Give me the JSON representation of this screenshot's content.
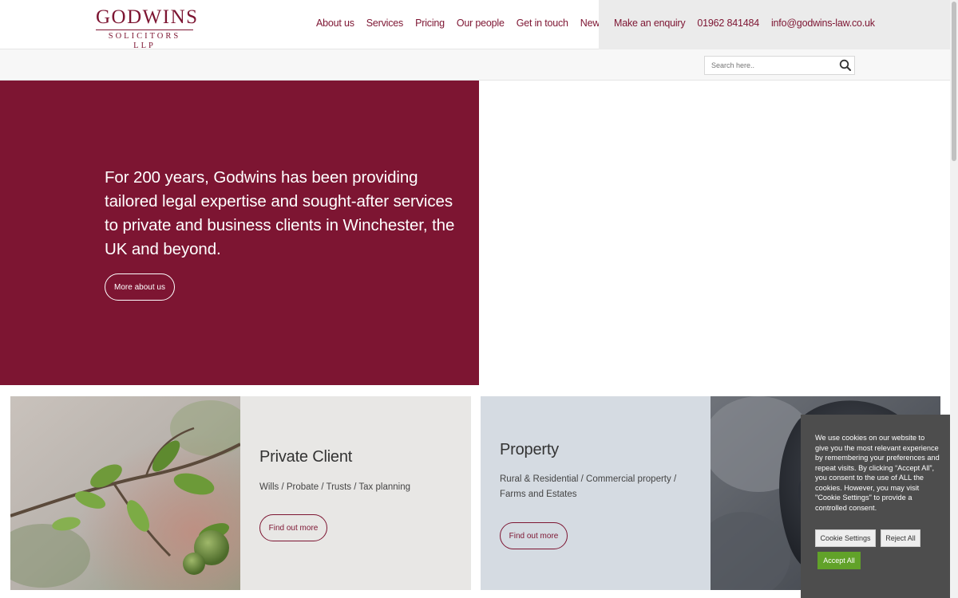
{
  "logo": {
    "main": "GODWINS",
    "sub": "SOLICITORS LLP"
  },
  "nav": [
    {
      "label": "About us"
    },
    {
      "label": "Services"
    },
    {
      "label": "Pricing"
    },
    {
      "label": "Our people"
    },
    {
      "label": "Get in touch"
    },
    {
      "label": "News"
    }
  ],
  "contact": {
    "enquiry": "Make an enquiry",
    "phone": "01962 841484",
    "email": "info@godwins-law.co.uk"
  },
  "search": {
    "placeholder": "Search here..",
    "icon": "search-icon"
  },
  "hero": {
    "text": "For 200 years, Godwins has been providing tailored legal expertise and sought-after services to private and business clients in Winchester, the UK and beyond.",
    "button": "More about us"
  },
  "cards": [
    {
      "title": "Private Client",
      "desc": "Wills / Probate / Trusts / Tax planning",
      "button": "Find out more"
    },
    {
      "title": "Property",
      "desc": "Rural & Residential / Commercial property / Farms and Estates",
      "button": "Find out more"
    }
  ],
  "cookie": {
    "text": "We use cookies on our website to give you the most relevant experience by remembering your preferences and repeat visits. By clicking “Accept All”, you consent to the use of ALL the cookies. However, you may visit \"Cookie Settings\" to provide a controlled consent.",
    "settings": "Cookie Settings",
    "reject": "Reject All",
    "accept": "Accept All"
  },
  "colors": {
    "brand": "#7d1532",
    "contact_bg": "#ebebeb",
    "card1_panel": "#e8e7e5",
    "card2_panel": "#d5dbe2",
    "cookie_bg": "#4d4d4d",
    "accept": "#61a229"
  }
}
